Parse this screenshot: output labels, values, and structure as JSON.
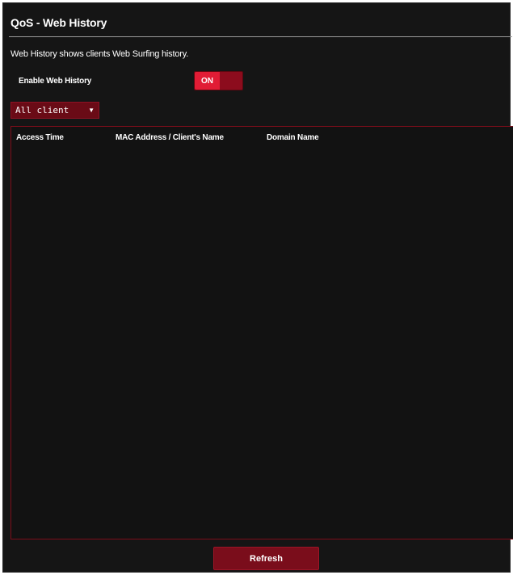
{
  "page": {
    "title": "QoS - Web History",
    "description": "Web History shows clients Web Surfing history."
  },
  "settings": {
    "enable_label": "Enable Web History",
    "toggle_state": "ON"
  },
  "filter": {
    "selected": "All client"
  },
  "table": {
    "columns": [
      "Access Time",
      "MAC Address / Client's Name",
      "Domain Name"
    ],
    "rows": []
  },
  "actions": {
    "refresh_label": "Refresh"
  },
  "colors": {
    "panel_bg": "#151515",
    "accent_red": "#e11c35",
    "dark_red": "#7a0d1b"
  }
}
